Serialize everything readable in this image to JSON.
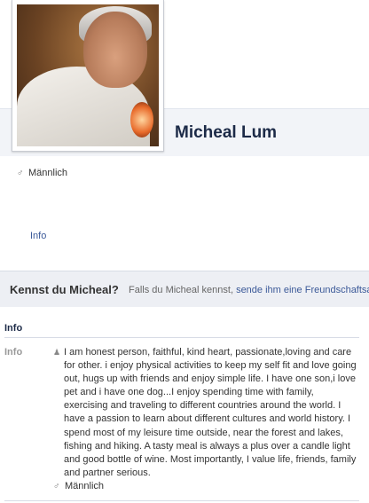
{
  "profile": {
    "name": "Micheal Lum",
    "gender": "Männlich",
    "gender_icon": "male-icon"
  },
  "tabs": {
    "info": "Info"
  },
  "know_box": {
    "title": "Kennst du Micheal?",
    "text": "Falls du Micheal kennst,",
    "link": "sende ihm eine Freundschaftsan"
  },
  "info_section": {
    "header": "Info",
    "label": "Info",
    "about_icon": "person-icon",
    "about": "I am honest person, faithful, kind heart, passionate,loving and care for other. i enjoy physical activities to keep my self fit and love going out, hugs up with friends and enjoy simple life. I have one son,i love pet and i have one dog...I enjoy spending time with family, exercising and traveling to different countries around the world. I have a passion to learn about different cultures and world history. I spend most of my leisure time outside, near the forest and lakes, fishing and hiking. A tasty meal is always a plus over a candle light and good bottle of wine. Most importantly, I value life, friends, family and partner serious.",
    "gender": "Männlich"
  },
  "colors": {
    "link": "#3b5998",
    "name": "#1c2a47",
    "band": "#edeff4"
  }
}
